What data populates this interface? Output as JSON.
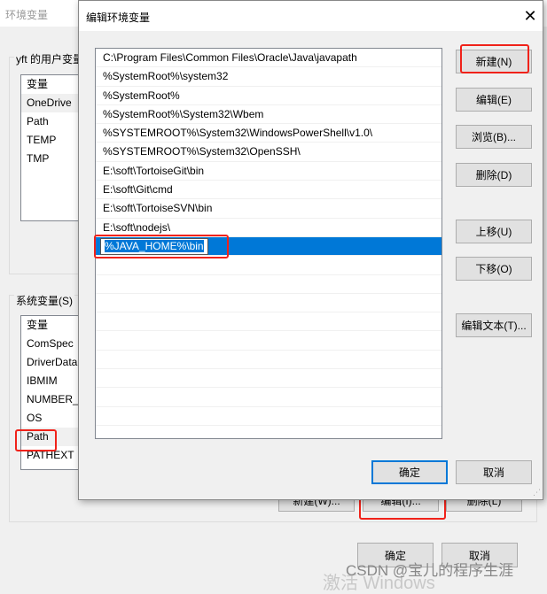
{
  "bg_window": {
    "title": "环境变量",
    "user_group": "yft 的用户变量",
    "user_header": "变量",
    "user_vars": [
      "OneDrive",
      "Path",
      "TEMP",
      "TMP"
    ],
    "sys_group": "系统变量(S)",
    "sys_header": "变量",
    "sys_vars": [
      "ComSpec",
      "DriverData",
      "IBMIM",
      "NUMBER_",
      "OS",
      "Path",
      "PATHEXT"
    ],
    "sys_buttons": [
      "新建(W)...",
      "编辑(I)...",
      "删除(L)"
    ],
    "ok": "确定",
    "cancel": "取消"
  },
  "dialog": {
    "title": "编辑环境变量",
    "close_icon": "close-icon",
    "paths": [
      "C:\\Program Files\\Common Files\\Oracle\\Java\\javapath",
      "%SystemRoot%\\system32",
      "%SystemRoot%",
      "%SystemRoot%\\System32\\Wbem",
      "%SYSTEMROOT%\\System32\\WindowsPowerShell\\v1.0\\",
      "%SYSTEMROOT%\\System32\\OpenSSH\\",
      "E:\\soft\\TortoiseGit\\bin",
      "E:\\soft\\Git\\cmd",
      "E:\\soft\\TortoiseSVN\\bin",
      "E:\\soft\\nodejs\\"
    ],
    "editing_value": "%JAVA_HOME%\\bin",
    "buttons": {
      "new": "新建(N)",
      "edit": "编辑(E)",
      "browse": "浏览(B)...",
      "delete": "删除(D)",
      "up": "上移(U)",
      "down": "下移(O)",
      "edit_text": "编辑文本(T)..."
    },
    "ok": "确定",
    "cancel": "取消"
  },
  "watermark": {
    "activate": "激活 Windows",
    "csdn": "CSDN @宝儿的程序生涯"
  },
  "colors": {
    "selection": "#0078d7",
    "highlight": "#f0221a"
  }
}
